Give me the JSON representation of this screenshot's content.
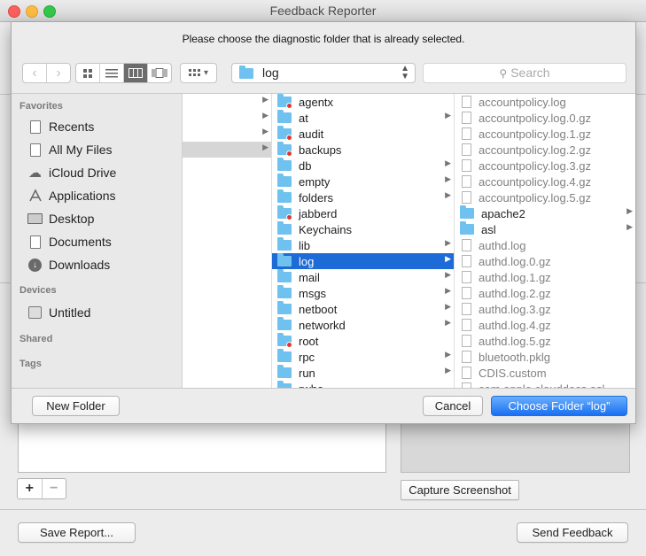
{
  "window": {
    "title": "Feedback Reporter"
  },
  "background": {
    "add_label": "+",
    "remove_label": "−",
    "capture_label": "Capture Screenshot",
    "save_label": "Save Report...",
    "send_label": "Send Feedback"
  },
  "dialog": {
    "message": "Please choose the diagnostic folder that is already selected.",
    "path": "log",
    "search_placeholder": "Search",
    "view_options_glyph": "▾",
    "sidebar": {
      "favorites_title": "Favorites",
      "favorites": [
        "Recents",
        "All My Files",
        "iCloud Drive",
        "Applications",
        "Desktop",
        "Documents",
        "Downloads"
      ],
      "devices_title": "Devices",
      "devices": [
        "Untitled"
      ],
      "shared_title": "Shared",
      "tags_title": "Tags"
    },
    "column2": [
      "agentx",
      "at",
      "audit",
      "backups",
      "db",
      "empty",
      "folders",
      "jabberd",
      "Keychains",
      "lib",
      "log",
      "mail",
      "msgs",
      "netboot",
      "networkd",
      "root",
      "rpc",
      "run",
      "rwho"
    ],
    "column3": [
      "accountpolicy.log",
      "accountpolicy.log.0.gz",
      "accountpolicy.log.1.gz",
      "accountpolicy.log.2.gz",
      "accountpolicy.log.3.gz",
      "accountpolicy.log.4.gz",
      "accountpolicy.log.5.gz",
      "apache2",
      "asl",
      "authd.log",
      "authd.log.0.gz",
      "authd.log.1.gz",
      "authd.log.2.gz",
      "authd.log.3.gz",
      "authd.log.4.gz",
      "authd.log.5.gz",
      "bluetooth.pklg",
      "CDIS.custom",
      "com.apple.clouddocs.asl"
    ],
    "new_folder_label": "New Folder",
    "cancel_label": "Cancel",
    "choose_label": "Choose Folder “log”"
  },
  "colors": {
    "selection": "#1d6bd7",
    "folder": "#6fc1ef",
    "primary_button": "#1a6ff3"
  }
}
